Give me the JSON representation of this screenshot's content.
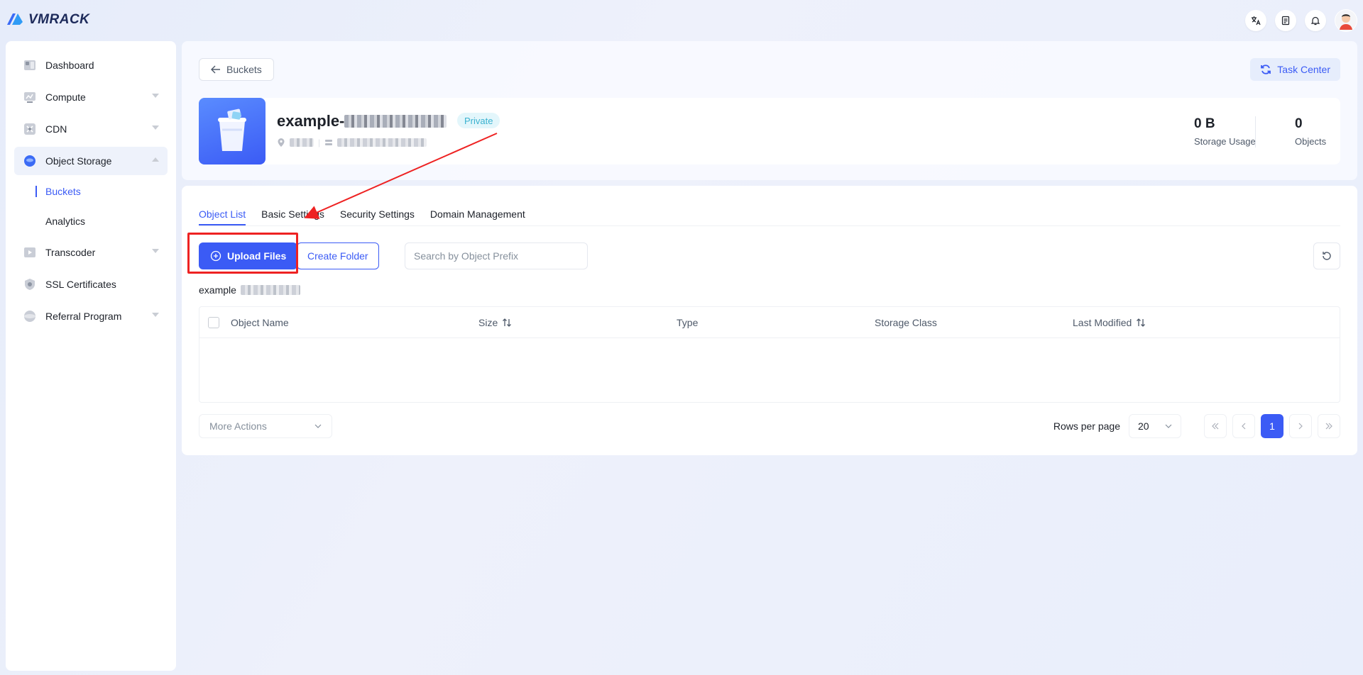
{
  "app": {
    "brand": "VMRACK"
  },
  "sidebar": {
    "items": [
      {
        "label": "Dashboard",
        "icon": "dashboard-icon",
        "expandable": false
      },
      {
        "label": "Compute",
        "icon": "compute-icon",
        "expandable": true
      },
      {
        "label": "CDN",
        "icon": "cdn-icon",
        "expandable": true
      },
      {
        "label": "Object Storage",
        "icon": "object-storage-icon",
        "expandable": true,
        "expanded": true
      },
      {
        "label": "Transcoder",
        "icon": "transcoder-icon",
        "expandable": true
      },
      {
        "label": "SSL Certificates",
        "icon": "ssl-icon",
        "expandable": false
      },
      {
        "label": "Referral Program",
        "icon": "referral-icon",
        "expandable": true
      }
    ],
    "sub_items": [
      {
        "label": "Buckets",
        "active": true
      },
      {
        "label": "Analytics",
        "active": false
      }
    ]
  },
  "header": {
    "back_label": "Buckets",
    "task_center_label": "Task Center",
    "bucket_name_prefix": "example-",
    "visibility": "Private",
    "storage_usage_value": "0 B",
    "storage_usage_label": "Storage Usage",
    "objects_value": "0",
    "objects_label": "Objects"
  },
  "tabs": [
    {
      "label": "Object List",
      "active": true
    },
    {
      "label": "Basic Settings",
      "active": false
    },
    {
      "label": "Security Settings",
      "active": false
    },
    {
      "label": "Domain Management",
      "active": false
    }
  ],
  "toolbar": {
    "upload_label": "Upload Files",
    "create_folder_label": "Create Folder",
    "search_placeholder": "Search by Object Prefix"
  },
  "path": {
    "prefix": "example"
  },
  "table": {
    "columns": [
      {
        "label": "Object Name",
        "sortable": false
      },
      {
        "label": "Size",
        "sortable": true
      },
      {
        "label": "Type",
        "sortable": false
      },
      {
        "label": "Storage Class",
        "sortable": false
      },
      {
        "label": "Last Modified",
        "sortable": true
      }
    ],
    "rows": []
  },
  "footer": {
    "more_actions_label": "More Actions",
    "rows_per_page_label": "Rows per page",
    "rows_per_page_value": "20",
    "current_page": "1"
  },
  "colors": {
    "accent": "#3b5bf5",
    "private_badge": "#3bb2d0",
    "annotation": "#ee2222"
  }
}
